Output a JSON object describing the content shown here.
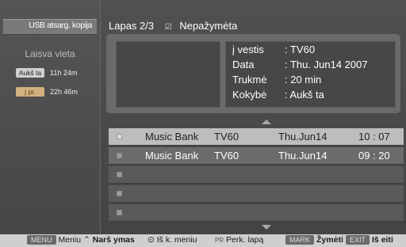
{
  "sidebar": {
    "title": "USB atsarg. kopija",
    "free_space_label": "Laisva vieta",
    "rows": [
      {
        "tag": "Aukš ta",
        "value": "11h 24m"
      },
      {
        "tag": "į pr.",
        "value": "22h 46m"
      }
    ]
  },
  "header": {
    "page": "Lapas 2/3",
    "check_icon": "☑",
    "unmarked": "Nepažymėta"
  },
  "details": {
    "input_label": "į vestis",
    "input_value": ": TV60",
    "date_label": "Data",
    "date_value": ": Thu. Jun14 2007",
    "duration_label": "Trukmė",
    "duration_value": ": 20 min",
    "quality_label": "Kokybė",
    "quality_value": ": Aukš ta"
  },
  "list": {
    "rows": [
      {
        "title": "Music Bank",
        "channel": "TV60",
        "date": "Thu.Jun14",
        "time": "10 : 07"
      },
      {
        "title": "Music Bank",
        "channel": "TV60",
        "date": "Thu.Jun14",
        "time": "09 : 20"
      },
      {
        "title": "",
        "channel": "",
        "date": "",
        "time": ""
      },
      {
        "title": "",
        "channel": "",
        "date": "",
        "time": ""
      },
      {
        "title": "",
        "channel": "",
        "date": "",
        "time": ""
      }
    ]
  },
  "footer": {
    "menu_badge": "MENU",
    "menu_text": "Meniu",
    "nav_icon": "⌃",
    "nav_text": "Narš ymas",
    "ok_icon": "⊙",
    "ok_text": "Iš k. meniu",
    "pr_small": "PR",
    "pr_text": "Perk. lapą",
    "mark_badge": "MARK",
    "mark_text": "Žymėti",
    "exit_badge": "EXIT",
    "exit_text": "Iš eiti"
  }
}
